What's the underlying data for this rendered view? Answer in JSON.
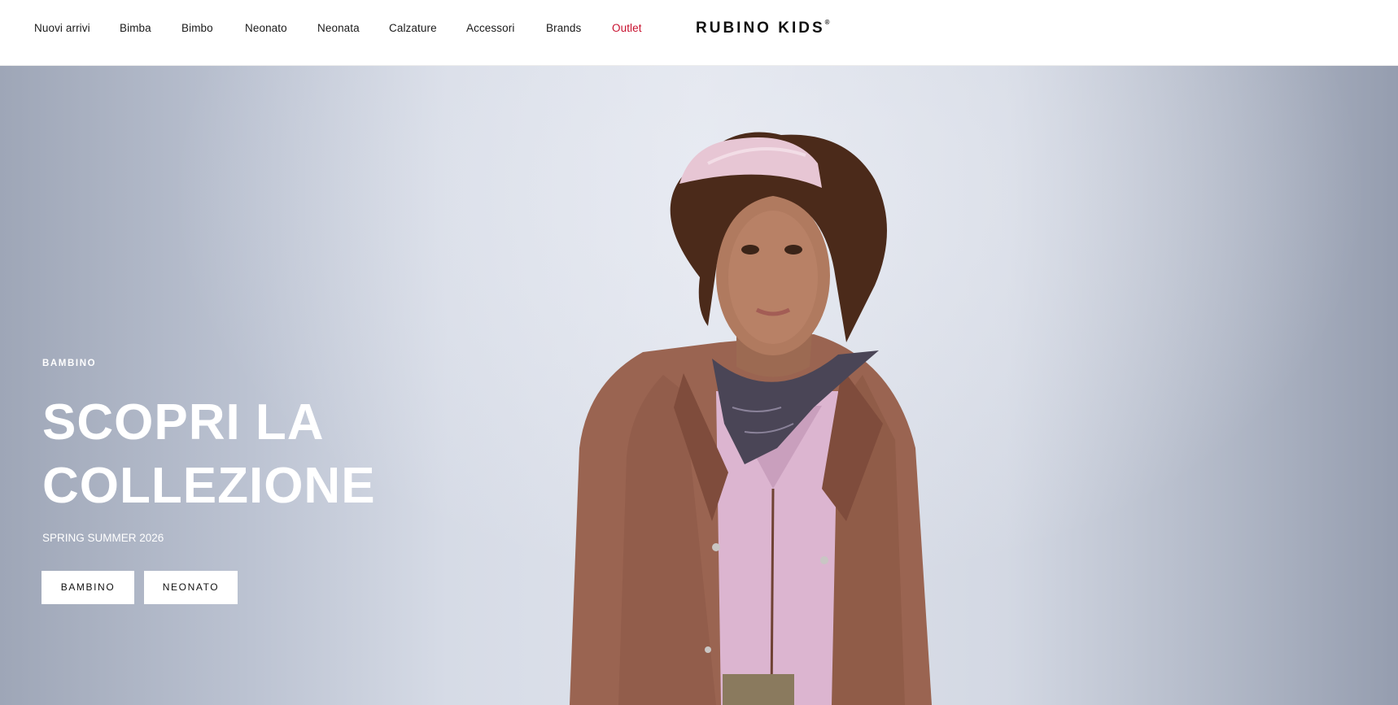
{
  "header": {
    "nav": [
      {
        "label": "Nuovi arrivi"
      },
      {
        "label": "Bimba"
      },
      {
        "label": "Bimbo"
      },
      {
        "label": "Neonato"
      },
      {
        "label": "Neonata"
      },
      {
        "label": "Calzature"
      },
      {
        "label": "Accessori"
      },
      {
        "label": "Brands"
      },
      {
        "label": "Outlet"
      }
    ],
    "logo": "RUBINO KIDS",
    "logo_mark": "®",
    "outlet_color": "#c8102e"
  },
  "hero": {
    "eyebrow": "BAMBINO",
    "headline_line1": "SCOPRI LA",
    "headline_line2": "COLLEZIONE",
    "subline": "SPRING SUMMER 2026",
    "buttons": [
      {
        "label": "BAMBINO"
      },
      {
        "label": "NEONATO"
      }
    ]
  }
}
